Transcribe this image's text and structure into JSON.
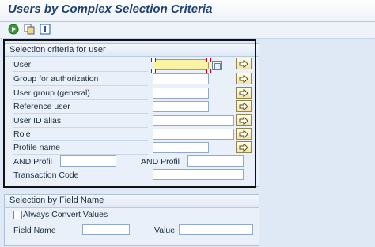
{
  "window": {
    "title": "Users by Complex Selection Criteria"
  },
  "toolbar": {
    "icons": [
      "execute-icon",
      "copy-icon",
      "info-icon"
    ]
  },
  "selection_group": {
    "header": "Selection criteria for user",
    "rows": [
      {
        "label": "User"
      },
      {
        "label": "Group for authorization"
      },
      {
        "label": "User group (general)"
      },
      {
        "label": "Reference user"
      },
      {
        "label": "User ID alias"
      },
      {
        "label": "Role"
      },
      {
        "label": "Profile name"
      }
    ],
    "and_profil_1": "AND Profil",
    "and_profil_2": "AND Profil",
    "transaction_code": "Transaction Code"
  },
  "field_group": {
    "header": "Selection by Field Name",
    "always_convert": "Always Convert Values",
    "field_name": "Field Name",
    "value": "Value"
  },
  "colors": {
    "accent": "#1d3f74",
    "active_input": "#fbf3a4",
    "outline": "#111111"
  }
}
